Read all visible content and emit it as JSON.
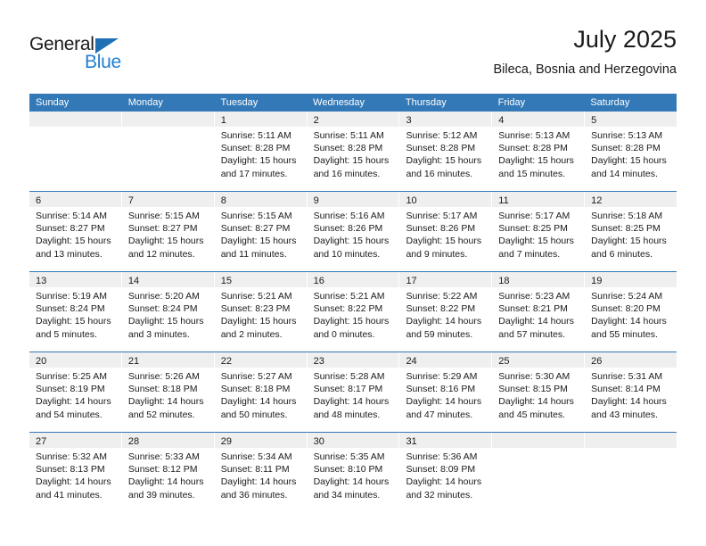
{
  "brand": {
    "name_top": "General",
    "name_bottom": "Blue",
    "accent_color": "#1f7fd4",
    "triangle_color": "#1f6fb5"
  },
  "header": {
    "title": "July 2025",
    "subtitle": "Bileca, Bosnia and Herzegovina"
  },
  "calendar": {
    "header_color": "#3379b7",
    "daynum_bar_color": "#efefef",
    "weekdays": [
      "Sunday",
      "Monday",
      "Tuesday",
      "Wednesday",
      "Thursday",
      "Friday",
      "Saturday"
    ],
    "weeks": [
      [
        {
          "day": "",
          "lines": []
        },
        {
          "day": "",
          "lines": []
        },
        {
          "day": "1",
          "lines": [
            "Sunrise: 5:11 AM",
            "Sunset: 8:28 PM",
            "Daylight: 15 hours",
            "and 17 minutes."
          ]
        },
        {
          "day": "2",
          "lines": [
            "Sunrise: 5:11 AM",
            "Sunset: 8:28 PM",
            "Daylight: 15 hours",
            "and 16 minutes."
          ]
        },
        {
          "day": "3",
          "lines": [
            "Sunrise: 5:12 AM",
            "Sunset: 8:28 PM",
            "Daylight: 15 hours",
            "and 16 minutes."
          ]
        },
        {
          "day": "4",
          "lines": [
            "Sunrise: 5:13 AM",
            "Sunset: 8:28 PM",
            "Daylight: 15 hours",
            "and 15 minutes."
          ]
        },
        {
          "day": "5",
          "lines": [
            "Sunrise: 5:13 AM",
            "Sunset: 8:28 PM",
            "Daylight: 15 hours",
            "and 14 minutes."
          ]
        }
      ],
      [
        {
          "day": "6",
          "lines": [
            "Sunrise: 5:14 AM",
            "Sunset: 8:27 PM",
            "Daylight: 15 hours",
            "and 13 minutes."
          ]
        },
        {
          "day": "7",
          "lines": [
            "Sunrise: 5:15 AM",
            "Sunset: 8:27 PM",
            "Daylight: 15 hours",
            "and 12 minutes."
          ]
        },
        {
          "day": "8",
          "lines": [
            "Sunrise: 5:15 AM",
            "Sunset: 8:27 PM",
            "Daylight: 15 hours",
            "and 11 minutes."
          ]
        },
        {
          "day": "9",
          "lines": [
            "Sunrise: 5:16 AM",
            "Sunset: 8:26 PM",
            "Daylight: 15 hours",
            "and 10 minutes."
          ]
        },
        {
          "day": "10",
          "lines": [
            "Sunrise: 5:17 AM",
            "Sunset: 8:26 PM",
            "Daylight: 15 hours",
            "and 9 minutes."
          ]
        },
        {
          "day": "11",
          "lines": [
            "Sunrise: 5:17 AM",
            "Sunset: 8:25 PM",
            "Daylight: 15 hours",
            "and 7 minutes."
          ]
        },
        {
          "day": "12",
          "lines": [
            "Sunrise: 5:18 AM",
            "Sunset: 8:25 PM",
            "Daylight: 15 hours",
            "and 6 minutes."
          ]
        }
      ],
      [
        {
          "day": "13",
          "lines": [
            "Sunrise: 5:19 AM",
            "Sunset: 8:24 PM",
            "Daylight: 15 hours",
            "and 5 minutes."
          ]
        },
        {
          "day": "14",
          "lines": [
            "Sunrise: 5:20 AM",
            "Sunset: 8:24 PM",
            "Daylight: 15 hours",
            "and 3 minutes."
          ]
        },
        {
          "day": "15",
          "lines": [
            "Sunrise: 5:21 AM",
            "Sunset: 8:23 PM",
            "Daylight: 15 hours",
            "and 2 minutes."
          ]
        },
        {
          "day": "16",
          "lines": [
            "Sunrise: 5:21 AM",
            "Sunset: 8:22 PM",
            "Daylight: 15 hours",
            "and 0 minutes."
          ]
        },
        {
          "day": "17",
          "lines": [
            "Sunrise: 5:22 AM",
            "Sunset: 8:22 PM",
            "Daylight: 14 hours",
            "and 59 minutes."
          ]
        },
        {
          "day": "18",
          "lines": [
            "Sunrise: 5:23 AM",
            "Sunset: 8:21 PM",
            "Daylight: 14 hours",
            "and 57 minutes."
          ]
        },
        {
          "day": "19",
          "lines": [
            "Sunrise: 5:24 AM",
            "Sunset: 8:20 PM",
            "Daylight: 14 hours",
            "and 55 minutes."
          ]
        }
      ],
      [
        {
          "day": "20",
          "lines": [
            "Sunrise: 5:25 AM",
            "Sunset: 8:19 PM",
            "Daylight: 14 hours",
            "and 54 minutes."
          ]
        },
        {
          "day": "21",
          "lines": [
            "Sunrise: 5:26 AM",
            "Sunset: 8:18 PM",
            "Daylight: 14 hours",
            "and 52 minutes."
          ]
        },
        {
          "day": "22",
          "lines": [
            "Sunrise: 5:27 AM",
            "Sunset: 8:18 PM",
            "Daylight: 14 hours",
            "and 50 minutes."
          ]
        },
        {
          "day": "23",
          "lines": [
            "Sunrise: 5:28 AM",
            "Sunset: 8:17 PM",
            "Daylight: 14 hours",
            "and 48 minutes."
          ]
        },
        {
          "day": "24",
          "lines": [
            "Sunrise: 5:29 AM",
            "Sunset: 8:16 PM",
            "Daylight: 14 hours",
            "and 47 minutes."
          ]
        },
        {
          "day": "25",
          "lines": [
            "Sunrise: 5:30 AM",
            "Sunset: 8:15 PM",
            "Daylight: 14 hours",
            "and 45 minutes."
          ]
        },
        {
          "day": "26",
          "lines": [
            "Sunrise: 5:31 AM",
            "Sunset: 8:14 PM",
            "Daylight: 14 hours",
            "and 43 minutes."
          ]
        }
      ],
      [
        {
          "day": "27",
          "lines": [
            "Sunrise: 5:32 AM",
            "Sunset: 8:13 PM",
            "Daylight: 14 hours",
            "and 41 minutes."
          ]
        },
        {
          "day": "28",
          "lines": [
            "Sunrise: 5:33 AM",
            "Sunset: 8:12 PM",
            "Daylight: 14 hours",
            "and 39 minutes."
          ]
        },
        {
          "day": "29",
          "lines": [
            "Sunrise: 5:34 AM",
            "Sunset: 8:11 PM",
            "Daylight: 14 hours",
            "and 36 minutes."
          ]
        },
        {
          "day": "30",
          "lines": [
            "Sunrise: 5:35 AM",
            "Sunset: 8:10 PM",
            "Daylight: 14 hours",
            "and 34 minutes."
          ]
        },
        {
          "day": "31",
          "lines": [
            "Sunrise: 5:36 AM",
            "Sunset: 8:09 PM",
            "Daylight: 14 hours",
            "and 32 minutes."
          ]
        },
        {
          "day": "",
          "lines": []
        },
        {
          "day": "",
          "lines": []
        }
      ]
    ]
  }
}
